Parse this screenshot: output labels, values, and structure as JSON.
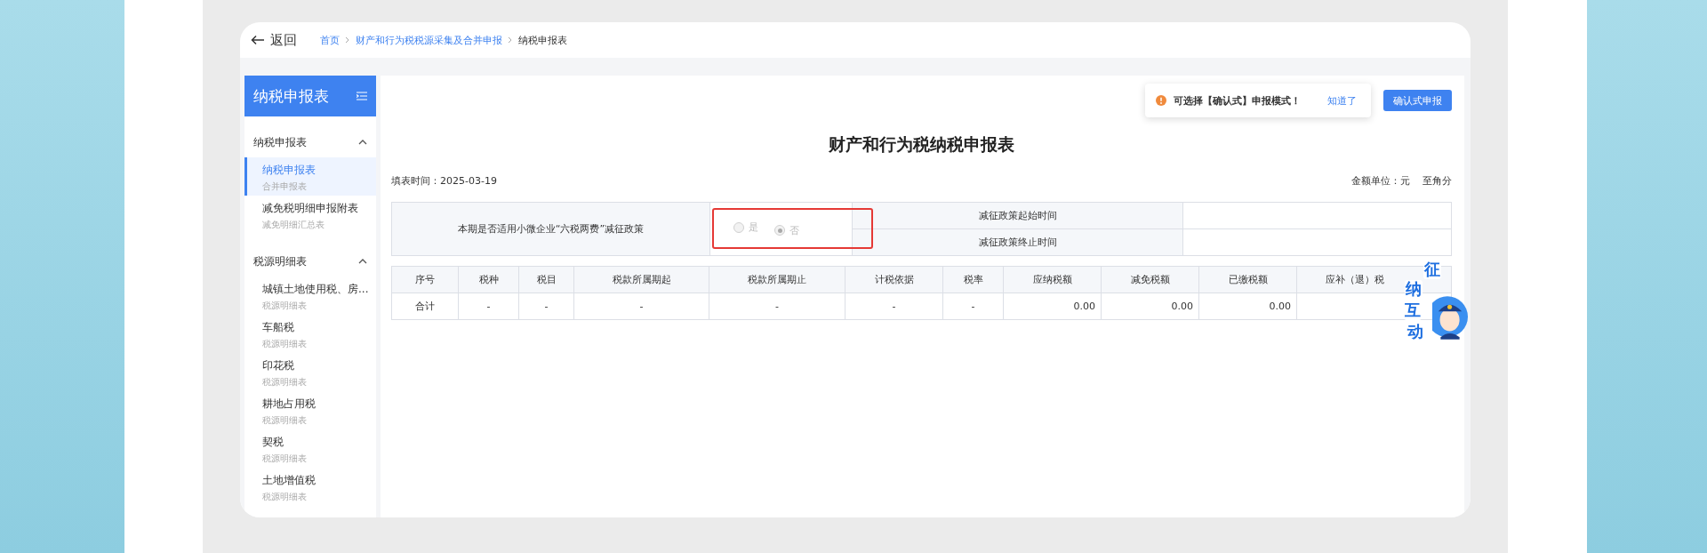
{
  "back": {
    "label": "返回"
  },
  "breadcrumb": [
    {
      "label": "首页",
      "link": true
    },
    {
      "label": "财产和行为税税源采集及合并申报",
      "link": true
    },
    {
      "label": "纳税申报表",
      "link": false
    }
  ],
  "sidebar": {
    "title": "纳税申报表",
    "groups": [
      {
        "label": "纳税申报表",
        "expanded": true,
        "items": [
          {
            "title": "纳税申报表",
            "subtitle": "合并申报表",
            "selected": true
          },
          {
            "title": "减免税明细申报附表",
            "subtitle": "减免明细汇总表",
            "selected": false
          }
        ]
      },
      {
        "label": "税源明细表",
        "expanded": true,
        "items": [
          {
            "title": "城镇土地使用税、房...",
            "subtitle": "税源明细表",
            "selected": false
          },
          {
            "title": "车船税",
            "subtitle": "税源明细表",
            "selected": false
          },
          {
            "title": "印花税",
            "subtitle": "税源明细表",
            "selected": false
          },
          {
            "title": "耕地占用税",
            "subtitle": "税源明细表",
            "selected": false
          },
          {
            "title": "契税",
            "subtitle": "税源明细表",
            "selected": false
          },
          {
            "title": "土地增值税",
            "subtitle": "税源明细表",
            "selected": false
          }
        ]
      }
    ]
  },
  "notice": {
    "text": "可选择【确认式】申报模式！",
    "action": "知道了"
  },
  "confirm_button": {
    "label": "确认式申报"
  },
  "form": {
    "title": "财产和行为税纳税申报表",
    "fill_date": "填表时间：2025-03-19",
    "unit": "金额单位：元",
    "precision": "至角分"
  },
  "policy": {
    "question": "本期是否适用小微企业“六税两费”减征政策",
    "disabled": true,
    "options": [
      {
        "label": "是",
        "selected": false
      },
      {
        "label": "否",
        "selected": true
      }
    ],
    "fields": [
      {
        "label": "减征政策起始时间"
      },
      {
        "label": "减征政策终止时间"
      }
    ]
  },
  "table": {
    "columns": [
      {
        "label": "序号",
        "numeric": false
      },
      {
        "label": "税种",
        "numeric": false
      },
      {
        "label": "税目",
        "numeric": false
      },
      {
        "label": "税款所属期起",
        "numeric": false
      },
      {
        "label": "税款所属期止",
        "numeric": false
      },
      {
        "label": "计税依据",
        "numeric": false
      },
      {
        "label": "税率",
        "numeric": false
      },
      {
        "label": "应纳税额",
        "numeric": true
      },
      {
        "label": "减免税额",
        "numeric": true
      },
      {
        "label": "已缴税额",
        "numeric": true
      },
      {
        "label": "应补（退）税"
      }
    ],
    "rows": [
      {
        "cells": [
          "合计",
          "-",
          "-",
          "-",
          "-",
          "-",
          "-",
          "0.00",
          "0.00",
          "0.00"
        ]
      }
    ]
  },
  "mascot": {
    "caption": [
      "征",
      "纳",
      "互",
      "动"
    ]
  }
}
